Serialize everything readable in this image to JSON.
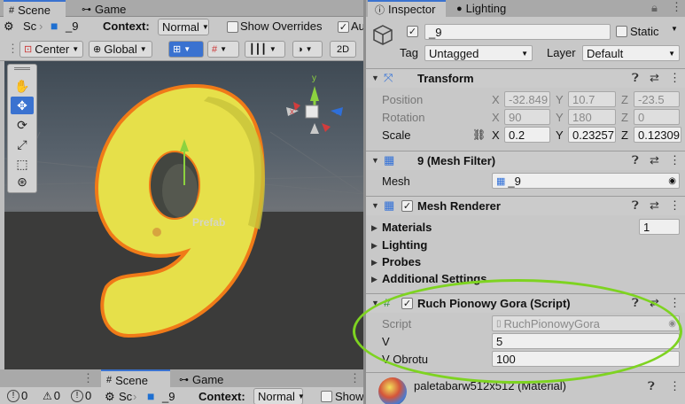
{
  "scene_top": {
    "tabs": [
      {
        "label": "Scene",
        "icon": "hash-icon"
      },
      {
        "label": "Game",
        "icon": "gamepad-icon"
      }
    ],
    "breadcrumb_root": "Sc",
    "breadcrumb_obj": "_9",
    "context_label": "Context:",
    "context_value": "Normal",
    "show_overrides": "Show Overrides",
    "au_label": "Au",
    "pivot": "Center",
    "space": "Global",
    "mode_2d": "2D",
    "prefab_label": "Prefab"
  },
  "scene_bottom": {
    "tabs": [
      {
        "label": "Scene"
      },
      {
        "label": "Game"
      }
    ],
    "breadcrumb_root": "Sc",
    "breadcrumb_obj": "_9",
    "context_label": "Context:",
    "context_value": "Normal",
    "show_label": "Show",
    "counts": [
      "0",
      "0",
      "0"
    ]
  },
  "inspector": {
    "tabs": [
      {
        "label": "Inspector"
      },
      {
        "label": "Lighting"
      }
    ],
    "object_name": "_9",
    "static_label": "Static",
    "tag_label": "Tag",
    "tag_value": "Untagged",
    "layer_label": "Layer",
    "layer_value": "Default",
    "transform": {
      "title": "Transform",
      "position_label": "Position",
      "rotation_label": "Rotation",
      "scale_label": "Scale",
      "position": {
        "x": "-32.849",
        "y": "10.7",
        "z": "-23.5"
      },
      "rotation": {
        "x": "90",
        "y": "180",
        "z": "0"
      },
      "scale": {
        "x": "0.2",
        "y": "0.23257",
        "z": "0.12309"
      }
    },
    "mesh_filter": {
      "title": "9 (Mesh Filter)",
      "mesh_label": "Mesh",
      "mesh_value": "_9"
    },
    "mesh_renderer": {
      "title": "Mesh Renderer",
      "materials_label": "Materials",
      "materials_count": "1",
      "lighting_label": "Lighting",
      "probes_label": "Probes",
      "additional_label": "Additional Settings"
    },
    "script_comp": {
      "title": "Ruch Pionowy Gora (Script)",
      "script_label": "Script",
      "script_value": "RuchPionowyGora",
      "v_label": "V",
      "v_value": "5",
      "vobrotu_label": "V Obrotu",
      "vobrotu_value": "100"
    },
    "material": {
      "name": "paletabarw512x512 (Material)"
    }
  },
  "axis_labels": {
    "x": "x",
    "y": "y",
    "z": "z"
  },
  "colors": {
    "accent": "#3a72d0",
    "highlight": "#7ed321",
    "mesh": "#e6e04a",
    "outline": "#f07a18"
  }
}
